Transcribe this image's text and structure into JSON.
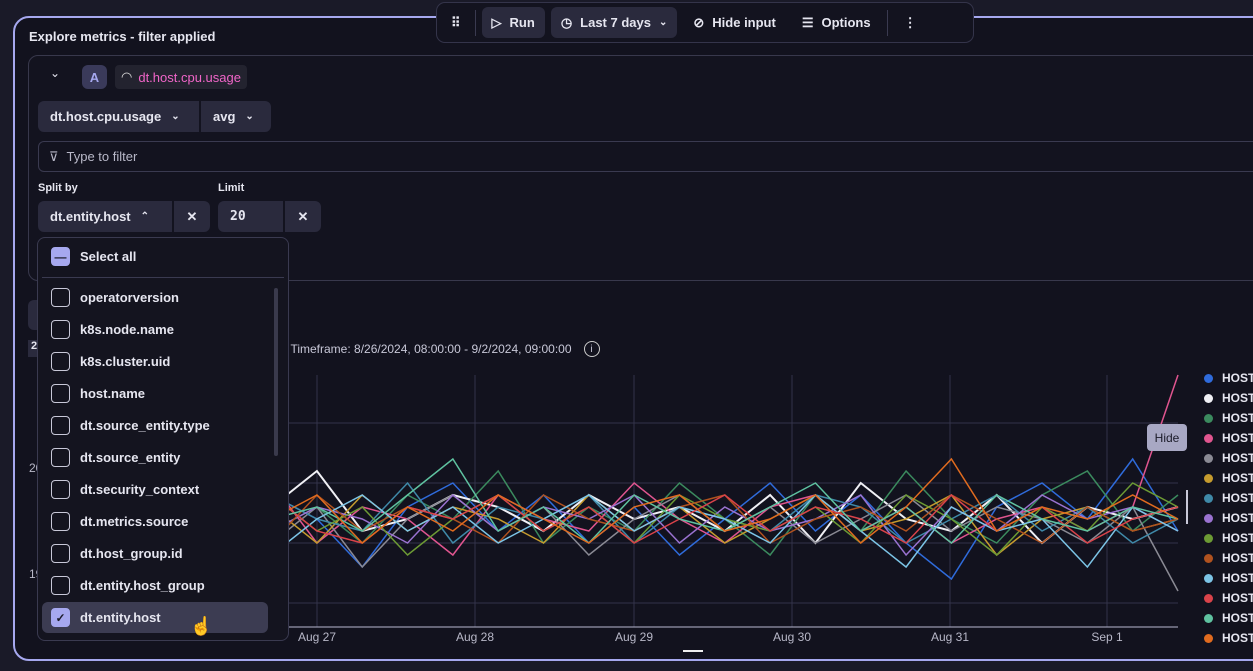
{
  "title": "Explore metrics - filter applied",
  "toolbar": {
    "run": "Run",
    "timeframe": "Last 7 days",
    "hide_input": "Hide input",
    "options": "Options"
  },
  "query": {
    "letter": "A",
    "metric_badge": "dt.host.cpu.usage",
    "metric_select": "dt.host.cpu.usage",
    "aggregation": "avg",
    "filter_placeholder": "Type to filter",
    "split_label": "Split by",
    "split_value": "dt.entity.host",
    "limit_label": "Limit",
    "limit_value": "20"
  },
  "dropdown": {
    "select_all": "Select all",
    "items": [
      {
        "label": "operatorversion",
        "checked": false
      },
      {
        "label": "k8s.node.name",
        "checked": false
      },
      {
        "label": "k8s.cluster.uid",
        "checked": false
      },
      {
        "label": "host.name",
        "checked": false
      },
      {
        "label": "dt.source_entity.type",
        "checked": false
      },
      {
        "label": "dt.source_entity",
        "checked": false
      },
      {
        "label": "dt.security_context",
        "checked": false
      },
      {
        "label": "dt.metrics.source",
        "checked": false
      },
      {
        "label": "dt.host_group.id",
        "checked": false
      },
      {
        "label": "dt.entity.host_group",
        "checked": false
      },
      {
        "label": "dt.entity.host",
        "checked": true
      }
    ]
  },
  "badge_partial": "2",
  "info": ", Timeframe: 8/26/2024, 08:00:00 - 9/2/2024, 09:00:00",
  "tooltip": "Hide",
  "chart_data": {
    "type": "line",
    "xticks": [
      "Aug 27",
      "Aug 28",
      "Aug 29",
      "Aug 30",
      "Aug 31",
      "Sep 1"
    ],
    "yticks": [
      "20",
      "19"
    ],
    "ylim": [
      18.8,
      20.9
    ],
    "grid": true,
    "legend": "right",
    "series": [
      {
        "name": "HOST",
        "color": "#2f6bdb",
        "values": [
          19.6,
          19.8,
          19.5,
          20.1,
          19.4,
          19.9,
          19.7,
          19.3,
          19.8,
          20.0,
          19.6,
          19.9,
          19.5,
          19.8,
          19.4,
          19.7,
          20.0,
          19.6,
          19.9,
          19.5,
          19.2,
          19.8,
          20.0,
          19.7,
          20.2,
          19.6
        ]
      },
      {
        "name": "HOST",
        "color": "#f0f0f5",
        "values": [
          19.8,
          19.6,
          19.9,
          19.7,
          19.5,
          19.8,
          20.1,
          19.6,
          19.7,
          19.9,
          19.8,
          19.6,
          19.9,
          19.7,
          19.8,
          19.6,
          19.9,
          19.5,
          20.0,
          19.7,
          19.6,
          19.9,
          19.5,
          19.8,
          19.7,
          19.8
        ]
      },
      {
        "name": "HOST",
        "color": "#3b8a5e",
        "values": [
          19.5,
          19.9,
          19.7,
          19.4,
          20.0,
          19.6,
          19.8,
          19.5,
          19.9,
          19.7,
          20.1,
          19.5,
          19.8,
          19.6,
          20.0,
          19.7,
          19.4,
          19.9,
          19.6,
          20.1,
          19.7,
          19.5,
          19.9,
          20.1,
          19.6,
          19.9
        ]
      },
      {
        "name": "HOST",
        "color": "#e0558f",
        "values": [
          19.7,
          19.5,
          19.9,
          19.8,
          19.6,
          20.0,
          19.5,
          19.8,
          19.7,
          19.4,
          19.9,
          19.7,
          19.6,
          20.0,
          19.7,
          19.5,
          19.8,
          19.9,
          19.6,
          19.8,
          19.5,
          19.7,
          19.8,
          19.6,
          19.8,
          20.9
        ]
      },
      {
        "name": "HOST",
        "color": "#8a8a94",
        "values": [
          19.6,
          19.7,
          19.4,
          19.9,
          19.7,
          19.5,
          19.8,
          19.3,
          19.7,
          19.9,
          19.6,
          19.8,
          19.4,
          19.7,
          19.9,
          19.6,
          19.8,
          19.5,
          19.7,
          19.9,
          19.6,
          19.8,
          19.7,
          19.5,
          19.8,
          19.1
        ]
      },
      {
        "name": "HOST",
        "color": "#c59b2e",
        "values": [
          19.8,
          19.5,
          19.7,
          19.9,
          19.6,
          19.8,
          19.5,
          19.9,
          19.6,
          19.8,
          19.7,
          19.5,
          19.9,
          19.6,
          19.8,
          19.5,
          19.7,
          19.9,
          19.6,
          19.7,
          19.9,
          19.4,
          19.7,
          19.8,
          19.6,
          19.7
        ]
      },
      {
        "name": "HOST",
        "color": "#3f89a8",
        "values": [
          19.7,
          20.0,
          19.6,
          19.8,
          19.5,
          19.9,
          19.7,
          19.6,
          20.0,
          19.5,
          19.8,
          19.7,
          19.9,
          19.5,
          19.8,
          19.7,
          19.6,
          19.9,
          19.8,
          19.5,
          19.7,
          19.9,
          19.6,
          19.8,
          19.5,
          19.7
        ]
      },
      {
        "name": "HOST",
        "color": "#9a72d0",
        "values": [
          19.6,
          19.8,
          19.5,
          19.7,
          19.9,
          19.6,
          19.8,
          19.7,
          19.5,
          19.9,
          19.6,
          19.8,
          19.7,
          19.9,
          19.5,
          19.8,
          19.6,
          19.7,
          19.9,
          19.4,
          19.8,
          19.6,
          19.9,
          19.7,
          19.8,
          19.6
        ]
      },
      {
        "name": "HOST",
        "color": "#6c9a34",
        "values": [
          19.8,
          19.6,
          20.1,
          19.7,
          19.5,
          19.9,
          19.6,
          19.8,
          19.4,
          19.7,
          19.9,
          19.6,
          19.8,
          19.5,
          19.9,
          19.7,
          19.6,
          19.8,
          19.5,
          19.9,
          19.7,
          19.4,
          19.8,
          19.6,
          20.0,
          19.8
        ]
      },
      {
        "name": "HOST",
        "color": "#b0521f",
        "values": [
          19.7,
          19.9,
          19.6,
          19.8,
          19.7,
          19.5,
          19.9,
          19.6,
          19.8,
          19.7,
          19.5,
          19.9,
          19.7,
          19.6,
          19.8,
          19.9,
          19.5,
          19.7,
          19.8,
          19.6,
          19.9,
          19.7,
          19.5,
          19.8,
          19.6,
          19.7
        ]
      },
      {
        "name": "HOST",
        "color": "#7cc4e6",
        "values": [
          19.5,
          19.7,
          19.9,
          19.6,
          19.8,
          19.4,
          19.7,
          19.9,
          19.6,
          19.8,
          19.5,
          19.7,
          19.9,
          19.6,
          19.8,
          19.7,
          19.5,
          19.9,
          19.6,
          19.3,
          19.8,
          19.6,
          19.7,
          19.3,
          19.8,
          19.6
        ]
      },
      {
        "name": "HOST",
        "color": "#d9434a",
        "values": [
          19.9,
          19.6,
          19.3,
          19.8,
          19.7,
          19.9,
          19.6,
          19.5,
          19.8,
          19.7,
          19.9,
          19.6,
          19.8,
          19.5,
          19.7,
          19.9,
          19.6,
          19.8,
          19.7,
          19.5,
          19.9,
          19.6,
          19.8,
          19.5,
          19.7,
          19.8
        ]
      },
      {
        "name": "HOST",
        "color": "#5fc2a0",
        "values": [
          19.6,
          19.8,
          19.7,
          19.5,
          19.9,
          19.7,
          19.8,
          19.6,
          19.9,
          20.2,
          19.6,
          19.8,
          19.5,
          19.9,
          19.7,
          19.6,
          19.8,
          20.0,
          19.6,
          19.8,
          19.5,
          19.9,
          19.7,
          19.6,
          19.8,
          19.7
        ]
      },
      {
        "name": "HOST",
        "color": "#e06b1f",
        "values": [
          19.7,
          19.5,
          19.8,
          19.9,
          19.6,
          19.7,
          19.9,
          19.5,
          19.8,
          19.6,
          19.9,
          19.7,
          19.5,
          19.8,
          19.9,
          19.6,
          19.7,
          19.9,
          19.5,
          19.8,
          20.2,
          19.6,
          19.8,
          19.7,
          19.9,
          19.7
        ]
      }
    ]
  }
}
